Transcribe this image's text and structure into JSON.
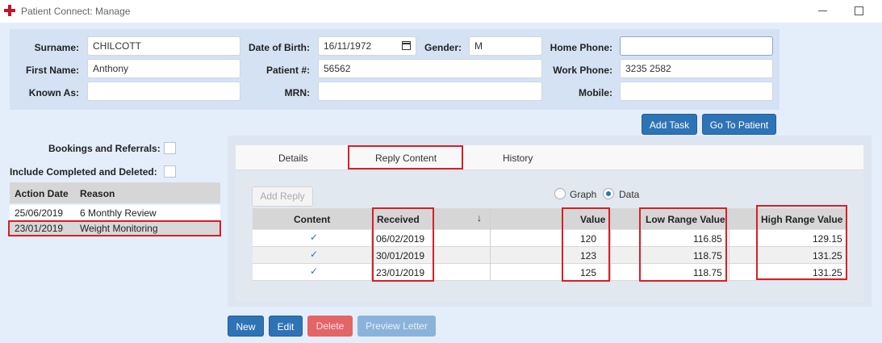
{
  "window": {
    "title": "Patient Connect: Manage",
    "minimize_glyph": "",
    "maximize_glyph": ""
  },
  "patient": {
    "surname_label": "Surname:",
    "surname": "CHILCOTT",
    "first_name_label": "First Name:",
    "first_name": "Anthony",
    "known_as_label": "Known As:",
    "known_as": "",
    "dob_label": "Date of Birth:",
    "dob": "16/11/1972",
    "patient_no_label": "Patient #:",
    "patient_no": "56562",
    "mrn_label": "MRN:",
    "mrn": "",
    "gender_label": "Gender:",
    "gender": "M",
    "home_phone_label": "Home Phone:",
    "home_phone": "",
    "work_phone_label": "Work Phone:",
    "work_phone": "3235 2582",
    "mobile_label": "Mobile:",
    "mobile": ""
  },
  "actions": {
    "add_task": "Add Task",
    "go_to_patient": "Go To Patient"
  },
  "filters": {
    "bookings_label": "Bookings and Referrals:",
    "include_completed_label": "Include Completed and Deleted:"
  },
  "bookings": {
    "columns": [
      "Action Date",
      "Reason"
    ],
    "rows": [
      {
        "date": "25/06/2019",
        "reason": "6 Monthly Review"
      },
      {
        "date": "23/01/2019",
        "reason": "Weight Monitoring"
      }
    ]
  },
  "tabs": [
    "Details",
    "Reply Content",
    "History"
  ],
  "reply": {
    "add_reply": "Add Reply",
    "view_graph": "Graph",
    "view_data": "Data",
    "selected_view": "Data",
    "columns": [
      "Content",
      "Received",
      "Value",
      "Low Range Value",
      "High Range Value"
    ],
    "sort_indicator": "↓",
    "rows": [
      {
        "content": "✓",
        "received": "06/02/2019",
        "value": "120",
        "low": "116.85",
        "high": "129.15"
      },
      {
        "content": "✓",
        "received": "30/01/2019",
        "value": "123",
        "low": "118.75",
        "high": "131.25"
      },
      {
        "content": "✓",
        "received": "23/01/2019",
        "value": "125",
        "low": "118.75",
        "high": "131.25"
      }
    ]
  },
  "footer": {
    "new": "New",
    "edit": "Edit",
    "delete": "Delete",
    "preview_letter": "Preview Letter"
  },
  "colors": {
    "accent": "#2e73b5",
    "highlight": "#d81f26",
    "delete": "#e36565"
  }
}
